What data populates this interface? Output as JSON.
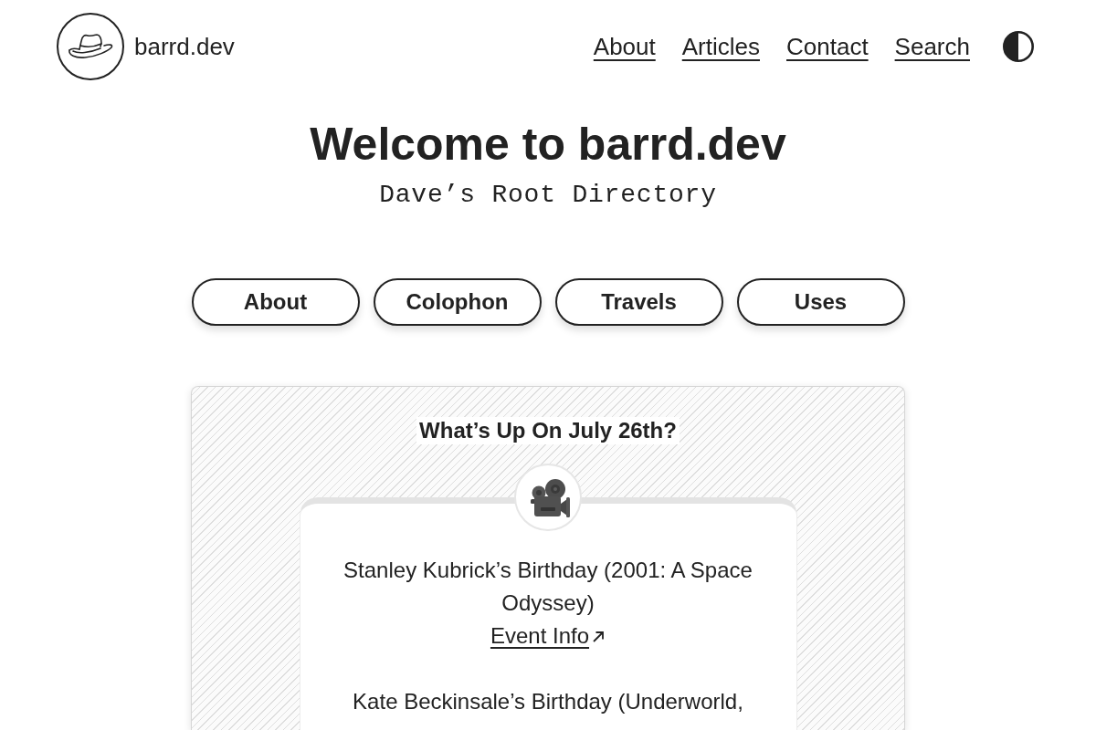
{
  "header": {
    "site_name": "barrd.dev",
    "nav": [
      "About",
      "Articles",
      "Contact",
      "Search"
    ]
  },
  "hero": {
    "title": "Welcome to barrd.dev",
    "subtitle": "Dave’s Root Directory"
  },
  "quick_links": [
    "About",
    "Colophon",
    "Travels",
    "Uses"
  ],
  "events": {
    "heading": "What’s Up On July 26th?",
    "items": [
      {
        "text": "Stanley Kubrick’s Birthday (2001: A Space Odyssey)",
        "link": "Event Info"
      },
      {
        "text": "Kate Beckinsale’s Birthday (Underworld,"
      }
    ]
  }
}
